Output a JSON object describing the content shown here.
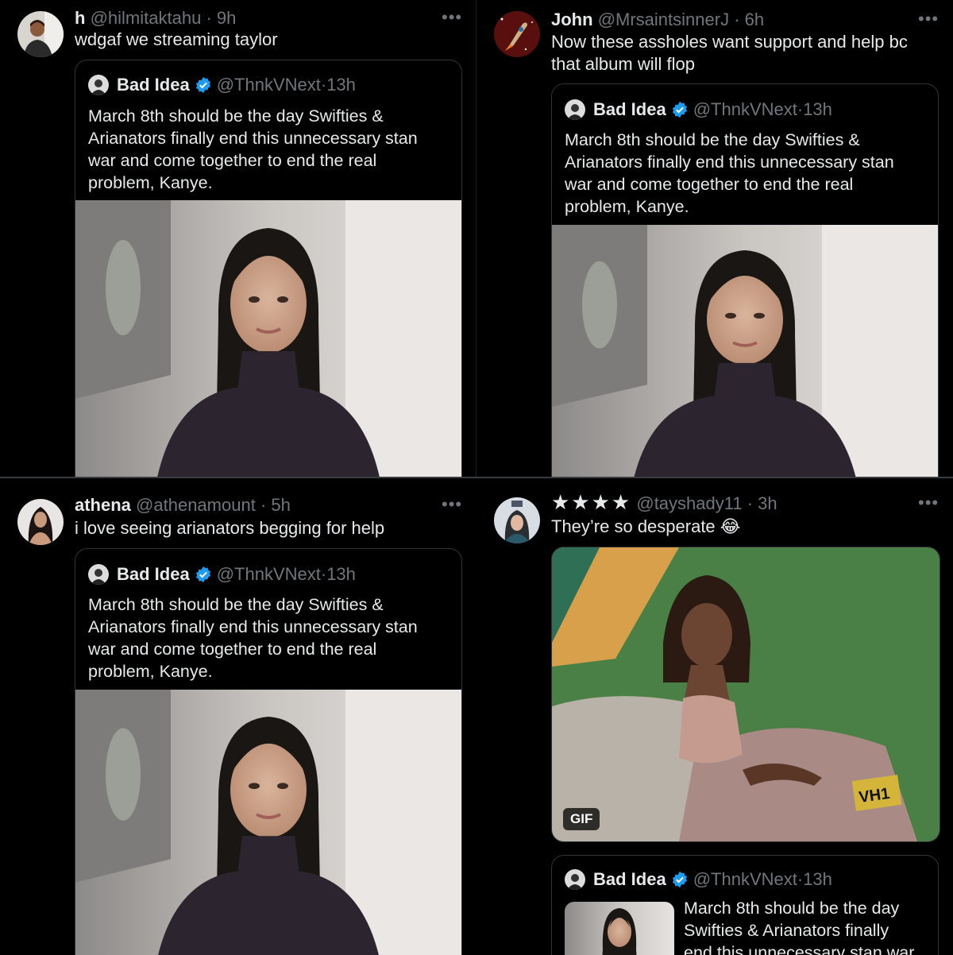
{
  "quoted_tweet": {
    "name": "Bad Idea",
    "handle": "@ThnkVNext",
    "dot": "·",
    "time": "13h",
    "text": "March 8th should be the day Swifties & Arianators finally end this unnecessary stan war and come together to end the real problem, Kanye.",
    "text_truncated_line1": "March 8th should be the day",
    "text_truncated_line2": "Swifties & Arianators finally",
    "text_truncated_line3": "end this unnecessary stan war"
  },
  "tweets": [
    {
      "name": "h",
      "handle": "@hilmitaktahu",
      "dot": "·",
      "time": "9h",
      "text": "wdgaf we streaming taylor"
    },
    {
      "name": "John",
      "handle": "@MrsaintsinnerJ",
      "dot": "·",
      "time": "6h",
      "text": "Now these assholes want support and help bc that album will flop"
    },
    {
      "name": "athena",
      "handle": "@athenamount",
      "dot": "·",
      "time": "5h",
      "text": "i love seeing arianators begging for help"
    },
    {
      "name": "★★★★",
      "handle": "@tayshady11",
      "dot": "·",
      "time": "3h",
      "text": "They’re so desperate 😂"
    }
  ],
  "more_label": "•••",
  "gif": {
    "badge": "GIF",
    "watermark": "VH1"
  },
  "colors": {
    "background": "#000000",
    "text": "#e7e9ea",
    "muted": "#71767b",
    "border": "#2f3336",
    "verified": "#1d9bf0",
    "stars": "#f4b400"
  },
  "icons": {
    "more": "more-horizontal-icon",
    "verified": "verified-badge-icon"
  }
}
